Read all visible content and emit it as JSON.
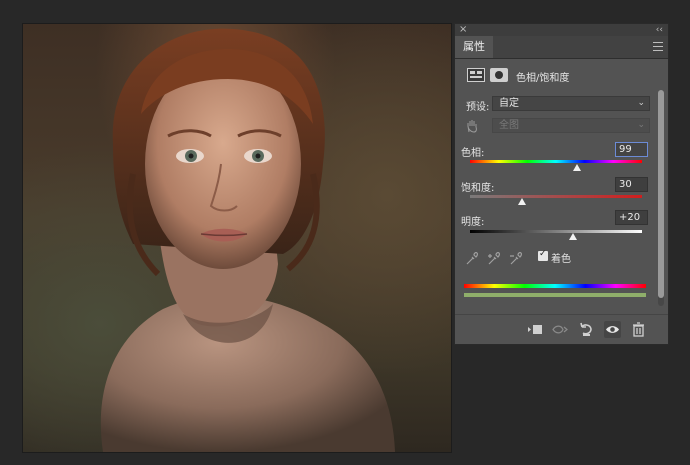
{
  "panel": {
    "close_glyph": "×",
    "collapse_glyph": "‹‹",
    "tab_label": "属性",
    "adjustment_title": "色相/饱和度",
    "preset_label": "预设:",
    "preset_value": "自定",
    "channel_value": "全图",
    "hue_label": "色相:",
    "hue_value": "99",
    "hue_level": 0.62,
    "saturation_label": "饱和度:",
    "saturation_value": "30",
    "saturation_level": 0.3,
    "lightness_label": "明度:",
    "lightness_value": "+20",
    "lightness_level": 0.6,
    "colorize_label": "着色",
    "colorize_checked": true,
    "colorize_color": "#8fae6a",
    "icons": [
      "adjustment-layer-icon",
      "layer-mask-icon",
      "hand-tool-icon",
      "eyedropper-icon",
      "eyedropper-plus-icon",
      "eyedropper-minus-icon",
      "clip-to-layer-icon",
      "view-previous-icon",
      "reset-icon",
      "visibility-icon",
      "trash-icon"
    ]
  }
}
